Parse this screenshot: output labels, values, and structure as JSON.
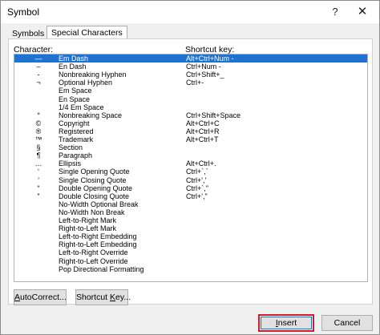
{
  "window": {
    "title": "Symbol",
    "help_glyph": "?",
    "close_glyph": "✕"
  },
  "tabs": [
    {
      "label": "Symbols"
    },
    {
      "label": "Special Characters"
    }
  ],
  "columns": {
    "character": "Character:",
    "shortcut": "Shortcut key:"
  },
  "rows": [
    {
      "glyph": "—",
      "name": "Em Dash",
      "key": "Alt+Ctrl+Num -",
      "selected": true
    },
    {
      "glyph": "–",
      "name": "En Dash",
      "key": "Ctrl+Num -"
    },
    {
      "glyph": "‑",
      "name": "Nonbreaking Hyphen",
      "key": "Ctrl+Shift+_"
    },
    {
      "glyph": "¬",
      "name": "Optional Hyphen",
      "key": "Ctrl+-"
    },
    {
      "glyph": "",
      "name": "Em Space",
      "key": ""
    },
    {
      "glyph": "",
      "name": "En Space",
      "key": ""
    },
    {
      "glyph": "",
      "name": "1/4 Em Space",
      "key": ""
    },
    {
      "glyph": "°",
      "name": "Nonbreaking Space",
      "key": "Ctrl+Shift+Space"
    },
    {
      "glyph": "©",
      "name": "Copyright",
      "key": "Alt+Ctrl+C"
    },
    {
      "glyph": "®",
      "name": "Registered",
      "key": "Alt+Ctrl+R"
    },
    {
      "glyph": "™",
      "name": "Trademark",
      "key": "Alt+Ctrl+T"
    },
    {
      "glyph": "§",
      "name": "Section",
      "key": ""
    },
    {
      "glyph": "¶",
      "name": "Paragraph",
      "key": ""
    },
    {
      "glyph": "…",
      "name": "Ellipsis",
      "key": "Alt+Ctrl+."
    },
    {
      "glyph": "‘",
      "name": "Single Opening Quote",
      "key": "Ctrl+`,`"
    },
    {
      "glyph": "’",
      "name": "Single Closing Quote",
      "key": "Ctrl+','"
    },
    {
      "glyph": "“",
      "name": "Double Opening Quote",
      "key": "Ctrl+`,\""
    },
    {
      "glyph": "”",
      "name": "Double Closing Quote",
      "key": "Ctrl+',\""
    },
    {
      "glyph": "",
      "name": "No-Width Optional Break",
      "key": ""
    },
    {
      "glyph": "",
      "name": "No-Width Non Break",
      "key": ""
    },
    {
      "glyph": "",
      "name": "Left-to-Right Mark",
      "key": ""
    },
    {
      "glyph": "",
      "name": "Right-to-Left Mark",
      "key": ""
    },
    {
      "glyph": "",
      "name": "Left-to-Right Embedding",
      "key": ""
    },
    {
      "glyph": "",
      "name": "Right-to-Left Embedding",
      "key": ""
    },
    {
      "glyph": "",
      "name": "Left-to-Right Override",
      "key": ""
    },
    {
      "glyph": "",
      "name": "Right-to-Left Override",
      "key": ""
    },
    {
      "glyph": "",
      "name": "Pop Directional Formatting",
      "key": ""
    }
  ],
  "buttons": {
    "autocorrect": "AutoCorrect...",
    "shortcut": "Shortcut Key...",
    "insert": "Insert",
    "cancel": "Cancel"
  },
  "colors": {
    "selection": "#1e73d2",
    "insert_highlight": "#d01b2a"
  }
}
